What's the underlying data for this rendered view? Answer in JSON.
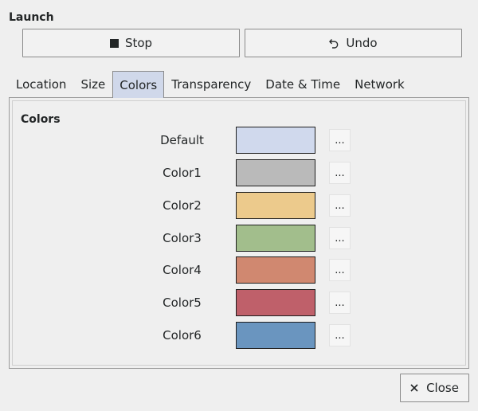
{
  "launch": {
    "title": "Launch",
    "stop_label": "Stop",
    "undo_label": "Undo"
  },
  "tabs": [
    {
      "label": "Location"
    },
    {
      "label": "Size"
    },
    {
      "label": "Colors"
    },
    {
      "label": "Transparency"
    },
    {
      "label": "Date & Time"
    },
    {
      "label": "Network"
    }
  ],
  "active_tab": "Colors",
  "colors_group": {
    "title": "Colors",
    "rows": [
      {
        "label": "Default",
        "color": "#d0d9ed",
        "button": "..."
      },
      {
        "label": "Color1",
        "color": "#bababa",
        "button": "..."
      },
      {
        "label": "Color2",
        "color": "#ecca8c",
        "button": "..."
      },
      {
        "label": "Color3",
        "color": "#a2be8c",
        "button": "..."
      },
      {
        "label": "Color4",
        "color": "#d08870",
        "button": "..."
      },
      {
        "label": "Color5",
        "color": "#bf606a",
        "button": "..."
      },
      {
        "label": "Color6",
        "color": "#6a95bf",
        "button": "..."
      }
    ]
  },
  "footer": {
    "close_label": "Close"
  },
  "icons": {
    "stop": "stop-square-icon",
    "undo": "undo-arrow-icon",
    "close": "close-x-icon"
  }
}
